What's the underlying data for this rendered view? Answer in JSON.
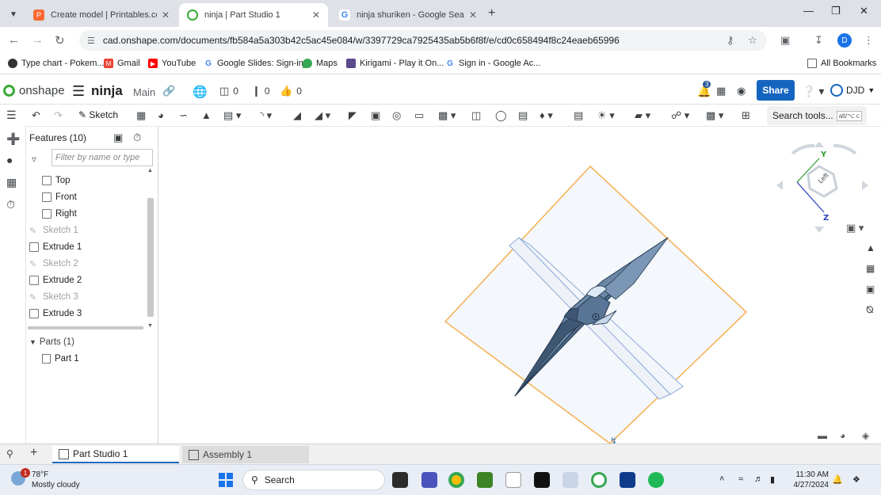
{
  "browser": {
    "tabs": [
      {
        "title": "Create model | Printables.com",
        "active": false,
        "favicon_color": "#fa6831"
      },
      {
        "title": "ninja | Part Studio 1",
        "active": true,
        "favicon_color": "#39a935"
      },
      {
        "title": "ninja shuriken - Google Search",
        "active": false,
        "favicon_color": "#4285f4"
      }
    ],
    "url": "cad.onshape.com/documents/fb584a5a303b42c5ac45e084/w/3397729ca7925435ab5b6f8f/e/cd0c658494f8c24eaeb65996",
    "profile_initial": "D",
    "bookmarks": [
      "Type chart - Pokem...",
      "Gmail",
      "YouTube",
      "Google Slides: Sign-in",
      "Maps",
      "Kirigami - Play it On...",
      "Sign in - Google Ac..."
    ],
    "all_bookmarks": "All Bookmarks"
  },
  "onshape": {
    "logo": "onshape",
    "doc_name": "ninja",
    "branch": "Main",
    "counters": {
      "versions": "0",
      "info": "0",
      "likes": "0"
    },
    "notifications": "3",
    "share_label": "Share",
    "user": "DJD",
    "sketch_label": "Sketch",
    "search_tools": "Search tools...",
    "search_shortcut": "alt/⌥ c"
  },
  "features": {
    "header": "Features (10)",
    "filter_placeholder": "Filter by name or type",
    "items": [
      {
        "label": "Top",
        "kind": "plane"
      },
      {
        "label": "Front",
        "kind": "plane"
      },
      {
        "label": "Right",
        "kind": "plane"
      },
      {
        "label": "Sketch 1",
        "kind": "sketch"
      },
      {
        "label": "Extrude 1",
        "kind": "extrude"
      },
      {
        "label": "Sketch 2",
        "kind": "sketch"
      },
      {
        "label": "Extrude 2",
        "kind": "extrude"
      },
      {
        "label": "Sketch 3",
        "kind": "sketch"
      },
      {
        "label": "Extrude 3",
        "kind": "extrude"
      }
    ],
    "parts_header": "Parts (1)",
    "parts": [
      "Part 1"
    ]
  },
  "viewcube": {
    "y_label": "Y",
    "z_label": "Z",
    "face_label": "Left"
  },
  "bottom_tabs": [
    {
      "label": "Part Studio 1",
      "active": true
    },
    {
      "label": "Assembly 1",
      "active": false
    }
  ],
  "taskbar": {
    "weather_temp": "78°F",
    "weather_desc": "Mostly cloudy",
    "weather_badge": "1",
    "search": "Search",
    "time": "11:30 AM",
    "date": "4/27/2024"
  }
}
